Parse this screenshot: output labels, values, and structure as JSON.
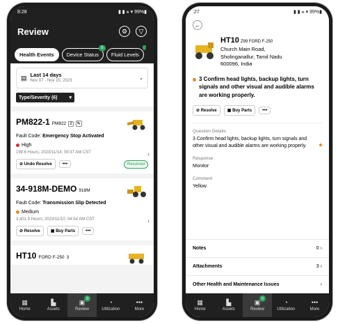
{
  "left": {
    "status": {
      "time": "8:28",
      "icons": "▮ ▮ ⚹ ▾ 99%▮"
    },
    "header": {
      "title": "Review",
      "settings_icon": "gear-icon",
      "filter_icon": "filter-icon"
    },
    "tabs": [
      {
        "label": "Health Events",
        "active": true
      },
      {
        "label": "Device Status",
        "badge": "5"
      },
      {
        "label": "Fluid Levels",
        "badge": ""
      }
    ],
    "date_range": {
      "title": "Last 14 days",
      "sub": "Nov 07 - Nov 20, 2023"
    },
    "type_filter": "Type/Severity (6)",
    "cards": [
      {
        "id": "PM822-1",
        "model": "PM822",
        "icon_count": "2",
        "fault_label": "Fault Code:",
        "fault": "Emergency Stop Activated",
        "severity": "High",
        "sev_color": "#d32f2f",
        "hours": "199.6 Hours; 2023/11/14; 09:37 AM CST",
        "btn1": "Undo Resolve",
        "resolved": "Resolved"
      },
      {
        "id": "34-918M-DEMO",
        "model": "918M",
        "fault_label": "Fault Code:",
        "fault": "Transmission Slip Detected",
        "severity": "Medium",
        "sev_color": "#ef8a1c",
        "hours": "3,401.9 Hours; 2023/11/10; 04:54 AM CST",
        "btn1": "Resolve",
        "btn2": "Buy Parts"
      },
      {
        "id": "HT10",
        "model": "FORD F-250",
        "icon_count": "3"
      }
    ],
    "nav": [
      {
        "label": "Home",
        "icon": "▦"
      },
      {
        "label": "Assets",
        "icon": "▙"
      },
      {
        "label": "Review",
        "icon": "▣",
        "badge": "9",
        "active": true
      },
      {
        "label": "Utilization",
        "icon": "◔"
      },
      {
        "label": "More",
        "icon": "•••"
      }
    ]
  },
  "right": {
    "status": {
      "time": ":27",
      "icons": "▮ ▮ ⚹ ▾ 99%▮"
    },
    "equip": {
      "id": "HT10",
      "model": "Z99 FORD F-250",
      "addr1": "Church Main Road,",
      "addr2": "Sholinganallur, Tamil Nadu",
      "addr3": "600096, India"
    },
    "issue": "3 Confirm head lights, backup lights, turn signals and other visual and audible alarms are working properly.",
    "btn1": "Resolve",
    "btn2": "Buy Parts",
    "qd_label": "Question Details",
    "qd_value": "3 Confirm head lights, backup lights, turn signals and other visual and audible alarms are working properly.",
    "resp_label": "Response",
    "resp_value": "Monitor",
    "comment_label": "Comment",
    "comment_value": "Yellow",
    "rows": [
      {
        "label": "Notes",
        "count": "0"
      },
      {
        "label": "Attachments",
        "count": "3"
      },
      {
        "label": "Other Health and Maintenance Issues",
        "count": ""
      }
    ],
    "nav": [
      {
        "label": "Home",
        "icon": "▦"
      },
      {
        "label": "Assets",
        "icon": "▙"
      },
      {
        "label": "Review",
        "icon": "▣",
        "badge": "9",
        "active": true
      },
      {
        "label": "Utilization",
        "icon": "◔"
      },
      {
        "label": "More",
        "icon": "•••"
      }
    ]
  }
}
